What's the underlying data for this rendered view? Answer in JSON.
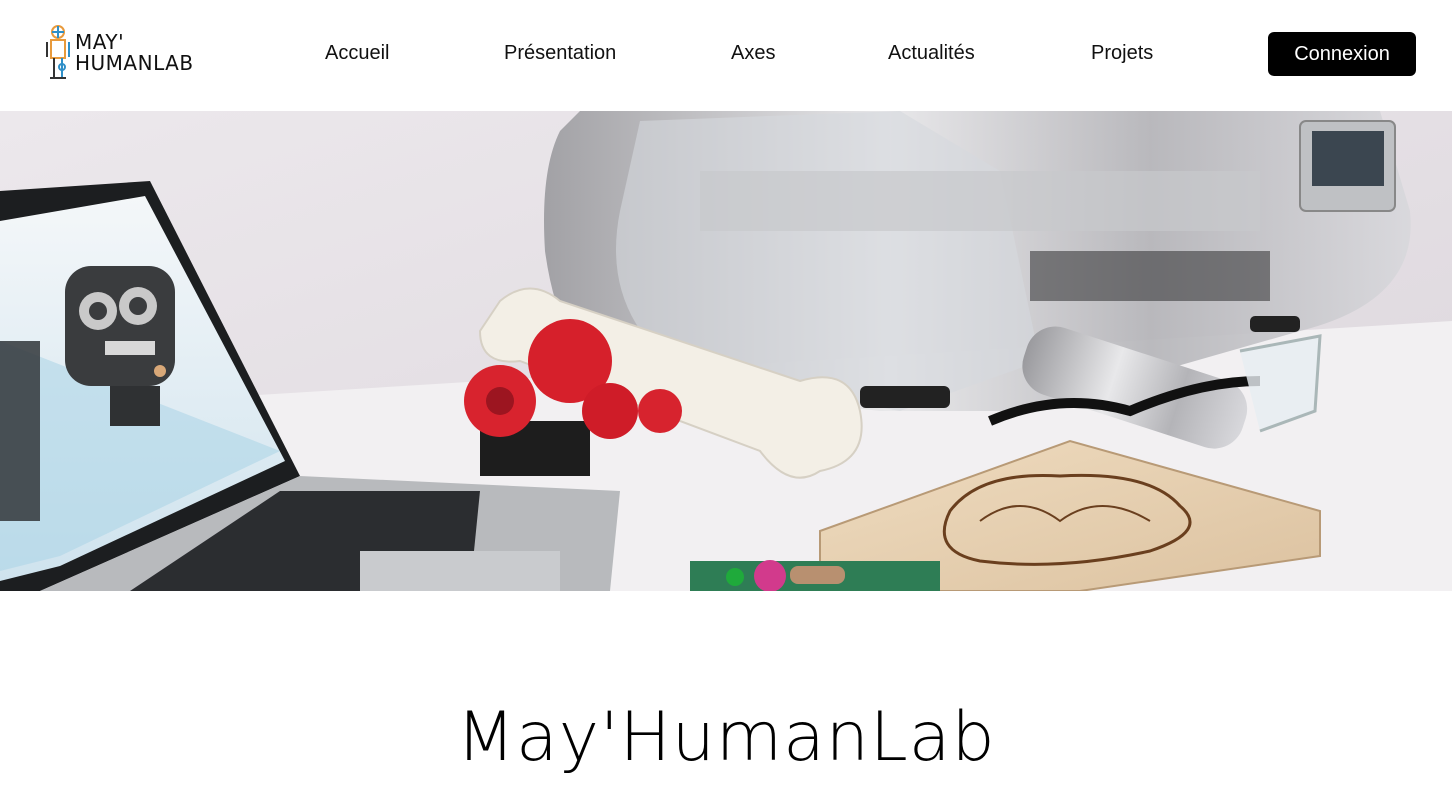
{
  "header": {
    "logo": {
      "line1": "MAY'",
      "line2": "HUMANLAB",
      "icon": "robot-figure-icon"
    },
    "nav": [
      {
        "label": "Accueil"
      },
      {
        "label": "Présentation"
      },
      {
        "label": "Axes"
      },
      {
        "label": "Actualités"
      },
      {
        "label": "Projets"
      }
    ],
    "login_label": "Connexion"
  },
  "hero": {
    "image": "makerlab-desk-photo",
    "content": "laptop with 3D model, 3D printer, printed bone, red gear assembly, laser-cut brain puzzle"
  },
  "main": {
    "title": "May'HumanLab"
  },
  "colors": {
    "button_bg": "#000000",
    "logo_orange": "#e89a3c",
    "logo_blue": "#2f8fc8"
  }
}
